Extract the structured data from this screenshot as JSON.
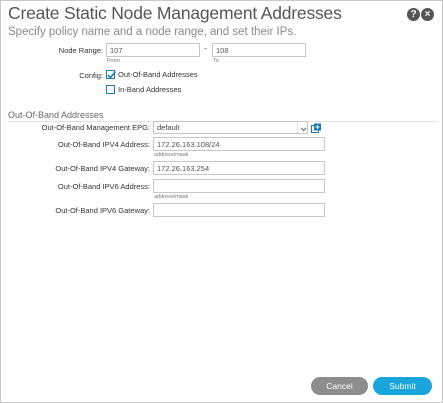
{
  "dialog": {
    "title": "Create Static Node Management Addresses",
    "subtitle": "Specify policy name and a node range, and set their IPs."
  },
  "header_icons": {
    "help": "?",
    "close": "×"
  },
  "node_range": {
    "label": "Node Range:",
    "from_value": "107",
    "from_hint": "From",
    "separator": "-",
    "to_value": "108",
    "to_hint": "To"
  },
  "config": {
    "label": "Config:",
    "options": [
      {
        "label": "Out-Of-Band Addresses",
        "checked": true
      },
      {
        "label": "In-Band Addresses",
        "checked": false
      }
    ]
  },
  "oob_section": {
    "title": "Out-Of-Band Addresses",
    "epg_label": "Out-Of-Band Management EPG:",
    "epg_value": "default",
    "ipv4_address_label": "Out-Of-Band IPV4 Address:",
    "ipv4_address_value": "172.26.163.108/24",
    "ipv4_address_hint": "address/mask",
    "ipv4_gateway_label": "Out-Of-Band IPV4 Gateway:",
    "ipv4_gateway_value": "172.26.163.254",
    "ipv6_address_label": "Out-Of-Band IPV6 Address:",
    "ipv6_address_value": "",
    "ipv6_address_hint": "address/mask",
    "ipv6_gateway_label": "Out-Of-Band IPV6 Gateway:",
    "ipv6_gateway_value": ""
  },
  "buttons": {
    "cancel": "Cancel",
    "submit": "Submit"
  },
  "colors": {
    "accent": "#1aa4dc",
    "cancel": "#8d8d8d",
    "checkbox": "#1a7bbf"
  }
}
